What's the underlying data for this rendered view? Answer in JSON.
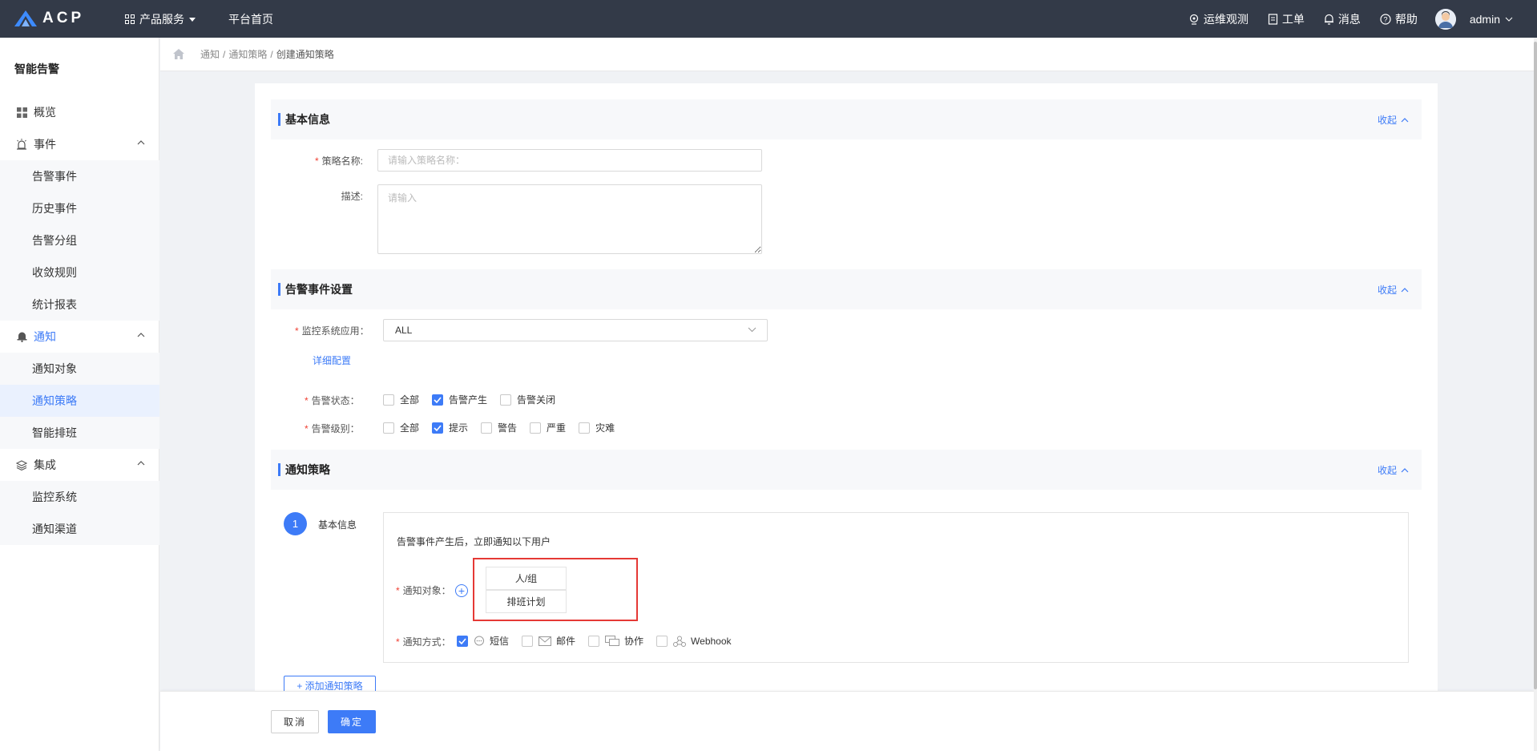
{
  "topbar": {
    "logo_text": "ACP",
    "products_label": "产品服务",
    "home_label": "平台首页",
    "right_items": [
      {
        "icon": "monitor-icon",
        "label": "运维观测"
      },
      {
        "icon": "ticket-icon",
        "label": "工单"
      },
      {
        "icon": "bell-icon",
        "label": "消息"
      },
      {
        "icon": "help-icon",
        "label": "帮助"
      }
    ],
    "user": "admin"
  },
  "sidebar": {
    "title": "智能告警",
    "overview": "概览",
    "events": {
      "label": "事件",
      "items": [
        "告警事件",
        "历史事件",
        "告警分组",
        "收敛规则",
        "统计报表"
      ]
    },
    "notify": {
      "label": "通知",
      "items": [
        "通知对象",
        "通知策略",
        "智能排班"
      ],
      "selected": "通知策略"
    },
    "integration": {
      "label": "集成",
      "items": [
        "监控系统",
        "通知渠道"
      ]
    }
  },
  "breadcrumb": {
    "parts": [
      "通知",
      "通知策略"
    ],
    "separator": "/",
    "current": "创建通知策略"
  },
  "basic_info": {
    "title": "基本信息",
    "collapse_label": "收起",
    "name_label": "策略名称:",
    "name_placeholder": "请输入策略名称：",
    "desc_label": "描述:",
    "desc_placeholder": "请输入"
  },
  "event_settings": {
    "title": "告警事件设置",
    "collapse_label": "收起",
    "monitor_label": "监控系统应用：",
    "monitor_value": "ALL",
    "detail_link": "详细配置",
    "status_label": "告警状态：",
    "status_options": [
      {
        "label": "全部",
        "checked": false
      },
      {
        "label": "告警产生",
        "checked": true
      },
      {
        "label": "告警关闭",
        "checked": false
      }
    ],
    "level_label": "告警级别：",
    "level_options": [
      {
        "label": "全部",
        "checked": false
      },
      {
        "label": "提示",
        "checked": true
      },
      {
        "label": "警告",
        "checked": false
      },
      {
        "label": "严重",
        "checked": false
      },
      {
        "label": "灾难",
        "checked": false
      }
    ]
  },
  "notify_policy": {
    "title": "通知策略",
    "collapse_label": "收起",
    "step_number": "1",
    "step_label": "基本信息",
    "description": "告警事件产生后，立即通知以下用户",
    "target_label": "通知对象：",
    "target_options": [
      "人/组",
      "排班计划"
    ],
    "method_label": "通知方式：",
    "methods": [
      {
        "label": "短信",
        "checked": true,
        "icon": "chat-icon"
      },
      {
        "label": "邮件",
        "checked": false,
        "icon": "mail-icon"
      },
      {
        "label": "协作",
        "checked": false,
        "icon": "collab-icon"
      },
      {
        "label": "Webhook",
        "checked": false,
        "icon": "webhook-icon"
      }
    ],
    "add_button": "+ 添加通知策略"
  },
  "footer": {
    "cancel": "取消",
    "confirm": "确定"
  },
  "colors": {
    "topbar": "#333a48",
    "accent": "#3d7bf7",
    "highlight_box": "#e53935",
    "required": "#f04134"
  }
}
